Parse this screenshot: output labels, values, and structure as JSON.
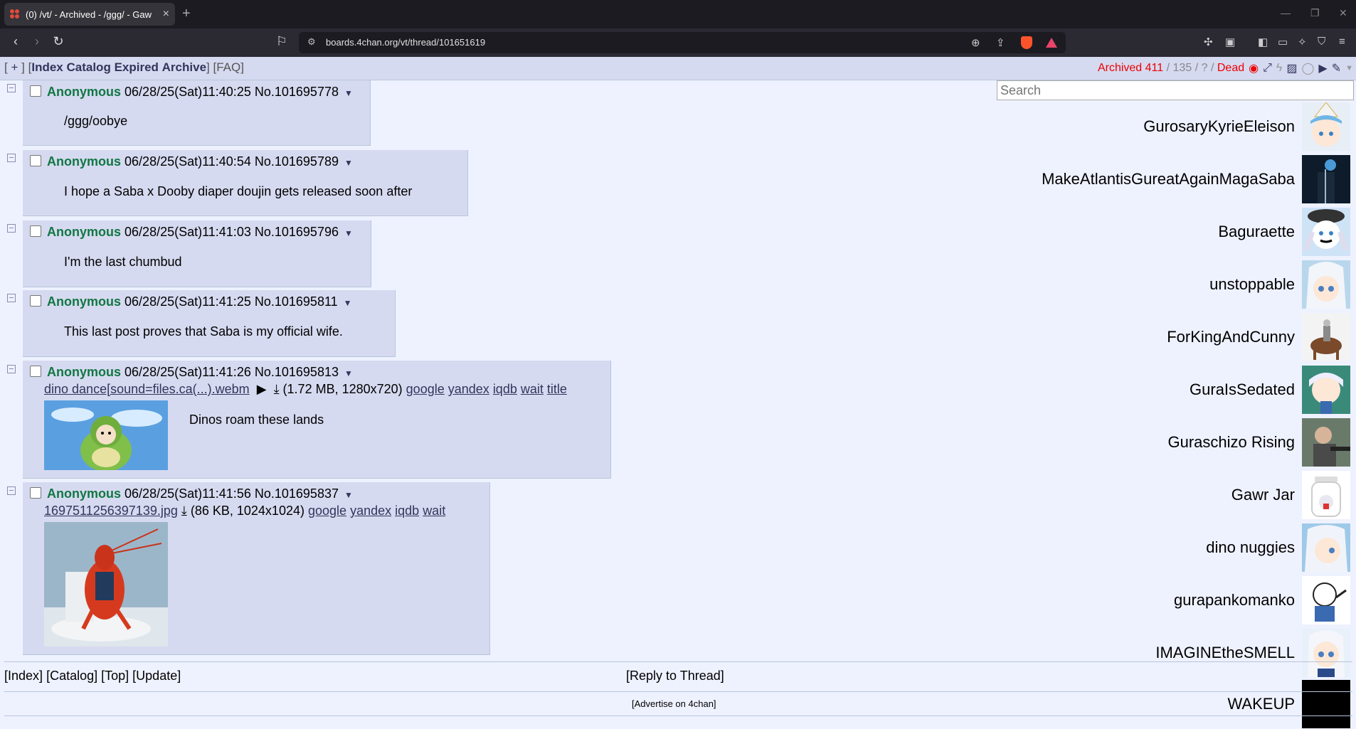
{
  "browser": {
    "tab_title": "(0) /vt/ - Archived - /ggg/ - Gaw",
    "url": "boards.4chan.org/vt/thread/101651619"
  },
  "boardnav": {
    "open_bracket": "[",
    "plus": "+",
    "close_bracket": "]",
    "links": [
      "Index",
      "Catalog",
      "Expired",
      "Archive"
    ],
    "faq": "[FAQ]",
    "archived_label": "Archived",
    "archived_count": "411",
    "separator": "/",
    "reply_count": "135",
    "image_count": "?",
    "status": "Dead"
  },
  "search": {
    "placeholder": "Search"
  },
  "posts": [
    {
      "name": "Anonymous",
      "date": "06/28/25(Sat)11:40:25",
      "no_label": "No.",
      "no": "101695778",
      "message": "/ggg/oobye"
    },
    {
      "name": "Anonymous",
      "date": "06/28/25(Sat)11:40:54",
      "no_label": "No.",
      "no": "101695789",
      "message": "I hope a Saba x Dooby diaper doujin gets released soon after"
    },
    {
      "name": "Anonymous",
      "date": "06/28/25(Sat)11:41:03",
      "no_label": "No.",
      "no": "101695796",
      "message": "I'm the last chumbud"
    },
    {
      "name": "Anonymous",
      "date": "06/28/25(Sat)11:41:25",
      "no_label": "No.",
      "no": "101695811",
      "message": "This last post proves that Saba is my official wife."
    },
    {
      "name": "Anonymous",
      "date": "06/28/25(Sat)11:41:26",
      "no_label": "No.",
      "no": "101695813",
      "file_name": "dino dance[sound=files.ca(...).webm",
      "file_meta": "(1.72 MB, 1280x720)",
      "file_links": [
        "google",
        "yandex",
        "iqdb",
        "wait",
        "title"
      ],
      "message": "Dinos roam these lands"
    },
    {
      "name": "Anonymous",
      "date": "06/28/25(Sat)11:41:56",
      "no_label": "No.",
      "no": "101695837",
      "file_name": "1697511256397139.jpg",
      "file_meta": "(86 KB, 1024x1024)",
      "file_links": [
        "google",
        "yandex",
        "iqdb",
        "wait"
      ]
    }
  ],
  "users": [
    "GurosaryKyrieEleison",
    "MakeAtlantisGureatAgainMagaSaba",
    "Baguraette",
    "unstoppable",
    "ForKingAndCunny",
    "GuraIsSedated",
    "Guraschizo Rising",
    "Gawr Jar",
    "dino nuggies",
    "gurapankomanko",
    "IMAGINEtheSMELL",
    "WAKEUP"
  ],
  "footer": {
    "links": [
      "[Index]",
      "[Catalog]",
      "[Top]",
      "[Update]"
    ],
    "reply": "[Reply to Thread]",
    "advertise_open": "[",
    "advertise": "Advertise on 4chan",
    "advertise_close": "]"
  },
  "colors": {
    "background": "#eef2ff",
    "post_bg": "#d6daf0",
    "name": "#117743",
    "link": "#34345c",
    "dead": "#ee0000"
  }
}
